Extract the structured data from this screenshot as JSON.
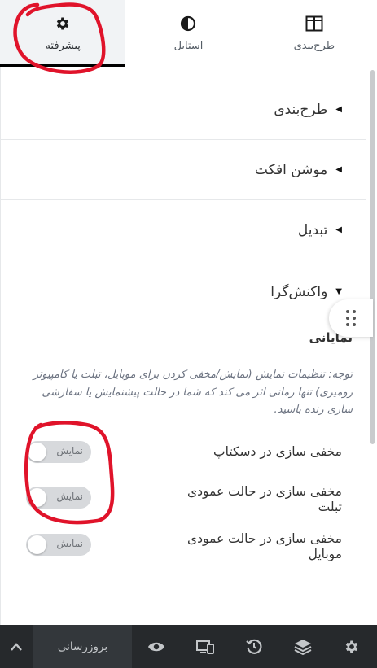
{
  "tabs": [
    {
      "label": "پیشرفته",
      "icon": "gear-icon",
      "active": true
    },
    {
      "label": "استایل",
      "icon": "half-circle-icon",
      "active": false
    },
    {
      "label": "طرح‌بندی",
      "icon": "layout-columns-icon",
      "active": false
    }
  ],
  "sections": [
    {
      "label": "طرح‌بندی"
    },
    {
      "label": "موشن افکت"
    },
    {
      "label": "تبدیل"
    }
  ],
  "open_section": {
    "label": "واکنش‌گرا",
    "subtitle": "نمایانی",
    "note": "توجه: تنظیمات نمایش (نمایش/مخفی کردن برای موبایل، تبلت یا کامپیوتر رومیزی) تنها زمانی اثر می کند که شما در حالت پیشنمایش یا سفارشی سازی زنده باشید.",
    "toggles": [
      {
        "label": "مخفی سازی در دسکتاپ",
        "state_text": "نمایش"
      },
      {
        "label": "مخفی سازی در حالت عمودی تبلت",
        "state_text": "نمایش"
      },
      {
        "label": "مخفی سازی در حالت عمودی موبایل",
        "state_text": "نمایش"
      }
    ]
  },
  "toolbar": {
    "publish_label": "بروزرسانی",
    "icons": [
      "chevron-up-icon",
      "eye-icon",
      "responsive-devices-icon",
      "history-icon",
      "layers-icon",
      "settings-gear-icon"
    ]
  },
  "colors": {
    "annotation": "#e0132a",
    "toolbar_bg": "#26292c",
    "active_tab_bg": "#f1f3f5"
  }
}
